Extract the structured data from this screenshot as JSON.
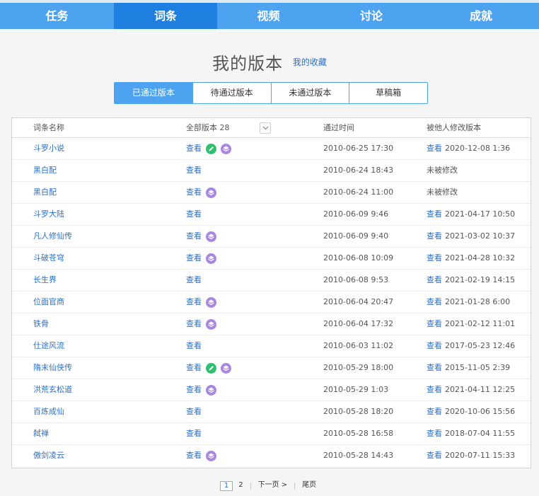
{
  "nav": {
    "items": [
      {
        "label": "任务"
      },
      {
        "label": "词条"
      },
      {
        "label": "视频"
      },
      {
        "label": "讨论"
      },
      {
        "label": "成就"
      }
    ],
    "active_index": 1
  },
  "header": {
    "title": "我的版本",
    "favorites_link": "我的收藏"
  },
  "tabs": [
    {
      "label": "已通过版本"
    },
    {
      "label": "待通过版本"
    },
    {
      "label": "未通过版本"
    },
    {
      "label": "草稿箱"
    }
  ],
  "active_tab": 0,
  "table": {
    "col_name": "词条名称",
    "col_versions": "全部版本 28",
    "col_time": "通过时间",
    "col_modified": "被他人修改版本",
    "view_label": "查看",
    "rows": [
      {
        "name": "斗罗小说",
        "edit_icon": true,
        "layers_icon": true,
        "time": "2010-06-25 17:30",
        "mod_view": "查看",
        "mod_time": "2020-12-08 1:36",
        "mod_text": ""
      },
      {
        "name": "黑白配",
        "edit_icon": false,
        "layers_icon": false,
        "time": "2010-06-24 18:43",
        "mod_view": "",
        "mod_time": "",
        "mod_text": "未被修改"
      },
      {
        "name": "黑白配",
        "edit_icon": false,
        "layers_icon": true,
        "time": "2010-06-24 11:00",
        "mod_view": "",
        "mod_time": "",
        "mod_text": "未被修改"
      },
      {
        "name": "斗罗大陆",
        "edit_icon": false,
        "layers_icon": false,
        "time": "2010-06-09 9:46",
        "mod_view": "查看",
        "mod_time": "2021-04-17 10:50",
        "mod_text": ""
      },
      {
        "name": "凡人修仙传",
        "edit_icon": false,
        "layers_icon": true,
        "time": "2010-06-09 9:40",
        "mod_view": "查看",
        "mod_time": "2021-03-02 10:37",
        "mod_text": ""
      },
      {
        "name": "斗破苍穹",
        "edit_icon": false,
        "layers_icon": true,
        "time": "2010-06-08 10:09",
        "mod_view": "查看",
        "mod_time": "2021-04-28 10:32",
        "mod_text": ""
      },
      {
        "name": "长生界",
        "edit_icon": false,
        "layers_icon": false,
        "time": "2010-06-08 9:53",
        "mod_view": "查看",
        "mod_time": "2021-02-19 14:15",
        "mod_text": ""
      },
      {
        "name": "位面官商",
        "edit_icon": false,
        "layers_icon": true,
        "time": "2010-06-04 20:47",
        "mod_view": "查看",
        "mod_time": "2021-01-28 6:00",
        "mod_text": ""
      },
      {
        "name": "铁骨",
        "edit_icon": false,
        "layers_icon": true,
        "time": "2010-06-04 17:32",
        "mod_view": "查看",
        "mod_time": "2021-02-12 11:01",
        "mod_text": ""
      },
      {
        "name": "仕途风流",
        "edit_icon": false,
        "layers_icon": false,
        "time": "2010-06-03 11:02",
        "mod_view": "查看",
        "mod_time": "2017-05-23 12:46",
        "mod_text": ""
      },
      {
        "name": "隋末仙侠传",
        "edit_icon": true,
        "layers_icon": true,
        "time": "2010-05-29 18:00",
        "mod_view": "查看",
        "mod_time": "2015-11-05 2:39",
        "mod_text": ""
      },
      {
        "name": "洪荒玄松道",
        "edit_icon": false,
        "layers_icon": true,
        "time": "2010-05-29 1:03",
        "mod_view": "查看",
        "mod_time": "2021-04-11 12:25",
        "mod_text": ""
      },
      {
        "name": "百炼成仙",
        "edit_icon": false,
        "layers_icon": false,
        "time": "2010-05-28 18:20",
        "mod_view": "查看",
        "mod_time": "2020-10-06 15:56",
        "mod_text": ""
      },
      {
        "name": "弑禅",
        "edit_icon": false,
        "layers_icon": false,
        "time": "2010-05-28 16:58",
        "mod_view": "查看",
        "mod_time": "2018-07-04 11:55",
        "mod_text": ""
      },
      {
        "name": "傲剑凌云",
        "edit_icon": false,
        "layers_icon": true,
        "time": "2010-05-28 14:43",
        "mod_view": "查看",
        "mod_time": "2020-07-11 15:33",
        "mod_text": ""
      }
    ]
  },
  "pager": {
    "pages": [
      "1",
      "2"
    ],
    "current": "1",
    "next": "下一页 >",
    "last": "尾页"
  },
  "colors": {
    "nav_bg": "#4da3ef",
    "nav_active": "#1e7fe0",
    "link": "#2b6fc7",
    "edit_icon": "#2fbf71",
    "layers_icon": "#a986e0"
  }
}
